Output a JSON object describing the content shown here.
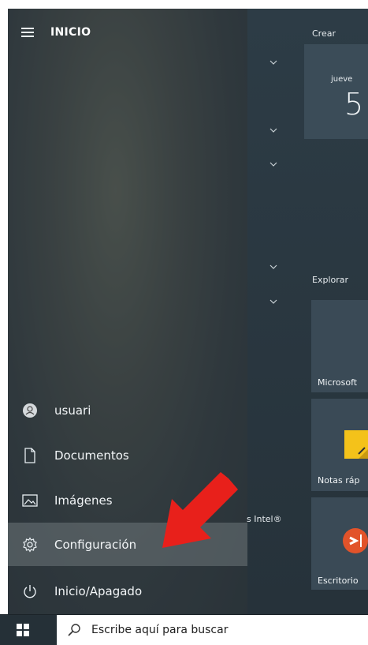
{
  "header": {
    "title": "INICIO"
  },
  "tiles": {
    "group1_label": "Crear",
    "group2_label": "Explorar",
    "calendar_day": "jueve",
    "calendar_date": "5",
    "tile_microsoft": "Microsoft",
    "tile_notas": "Notas ráp",
    "tile_escritorio": "Escritorio",
    "intel_fragment": "s Intel®"
  },
  "rail": {
    "items": [
      {
        "label": "usuari",
        "icon": "user-icon"
      },
      {
        "label": "Documentos",
        "icon": "document-icon"
      },
      {
        "label": "Imágenes",
        "icon": "pictures-icon"
      },
      {
        "label": "Configuración",
        "icon": "gear-icon"
      },
      {
        "label": "Inicio/Apagado",
        "icon": "power-icon"
      }
    ]
  },
  "taskbar": {
    "search_placeholder": "Escribe aquí para buscar"
  },
  "colors": {
    "accent_red": "#e8201b",
    "notes_yellow": "#f4c21a",
    "remote_orange": "#e2532a"
  }
}
